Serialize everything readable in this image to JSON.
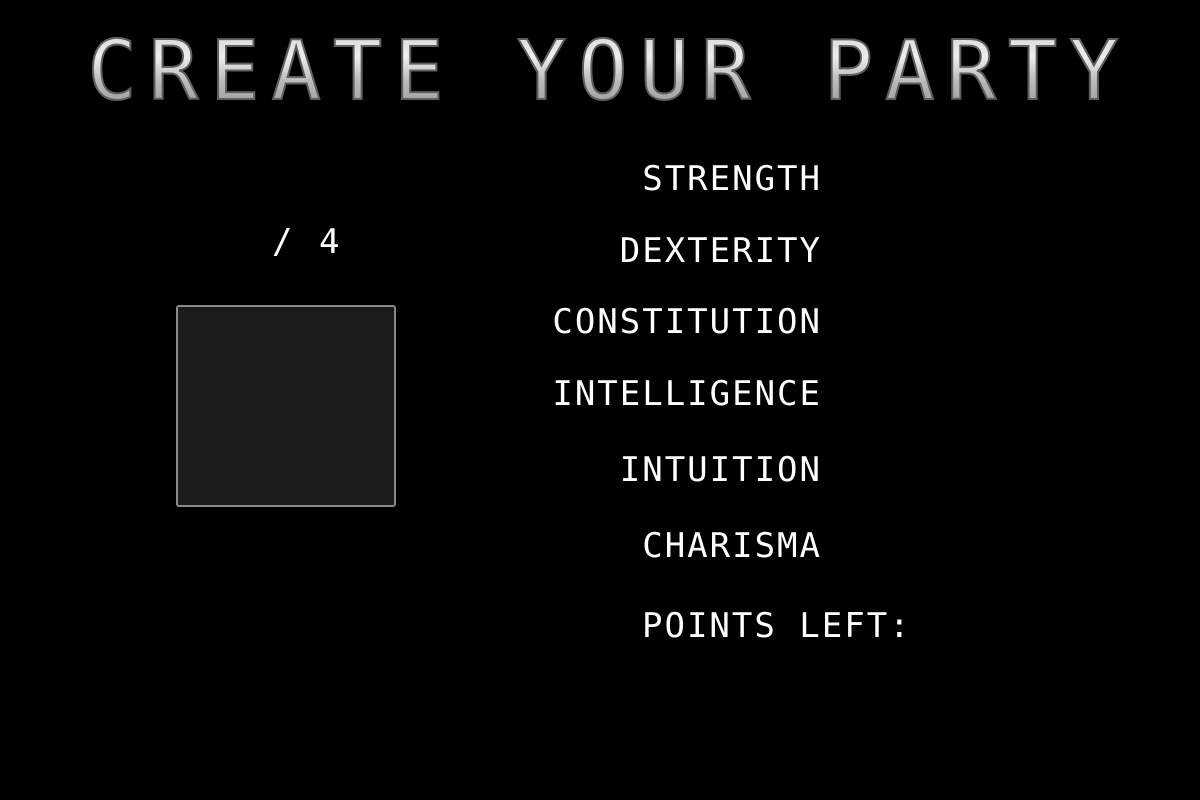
{
  "screen": {
    "title": "CREATE YOUR PARTY",
    "party_count": "/ 4"
  },
  "stats": {
    "strength": "STRENGTH",
    "dexterity": "DEXTERITY",
    "constitution": "CONSTITUTION",
    "intelligence": "INTELLIGENCE",
    "intuition": "INTUITION",
    "charisma": "CHARISMA"
  },
  "points": {
    "label": "POINTS LEFT:"
  },
  "colors": {
    "background": "#000000",
    "text": "#ffffff",
    "portrait_fill": "#1b1b1b",
    "portrait_border": "#8a8a8a"
  }
}
